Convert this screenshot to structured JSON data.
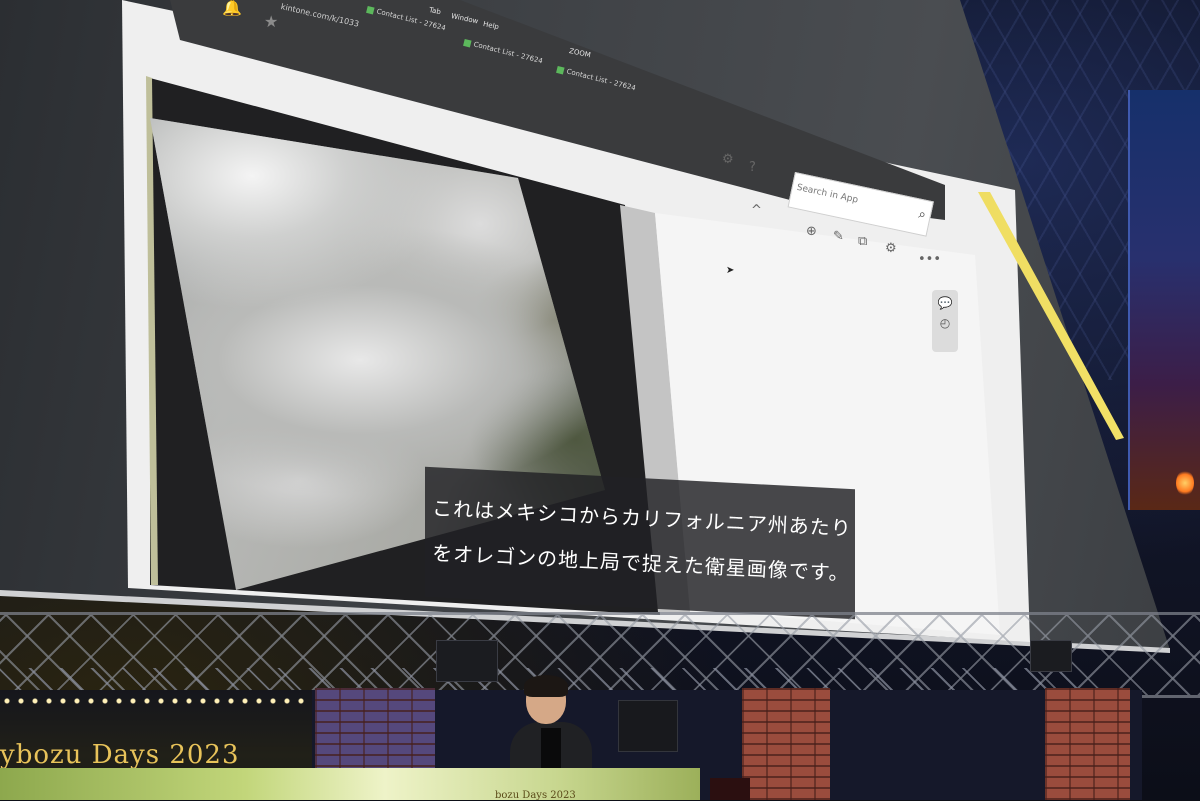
{
  "browser": {
    "url_fragment": "kintone.com/k/1033",
    "tabs": [
      "Contact List - 27624",
      "Contact List - 27624",
      "Contact List - 27624"
    ],
    "menu": [
      "Tab",
      "Window",
      "Help"
    ],
    "zoom_label": "ZOOM"
  },
  "app": {
    "search_placeholder": "Search in App"
  },
  "subtitle": {
    "line1": "これはメキシコからカリフォルニア州あたり",
    "line2": "をオレゴンの地上局で捉えた衛星画像です。"
  },
  "banner": {
    "title": "ybozu Days 2023",
    "podium_text": "bozu Days 2023"
  },
  "icons": {
    "bell": "bell-icon",
    "star": "star-icon",
    "gear": "gear-icon",
    "help": "help-icon",
    "search": "search-icon",
    "add": "add-icon",
    "edit": "edit-icon",
    "copy": "copy-icon",
    "settings": "settings-icon",
    "more": "more-icon",
    "comment": "comment-icon",
    "history": "history-icon"
  }
}
